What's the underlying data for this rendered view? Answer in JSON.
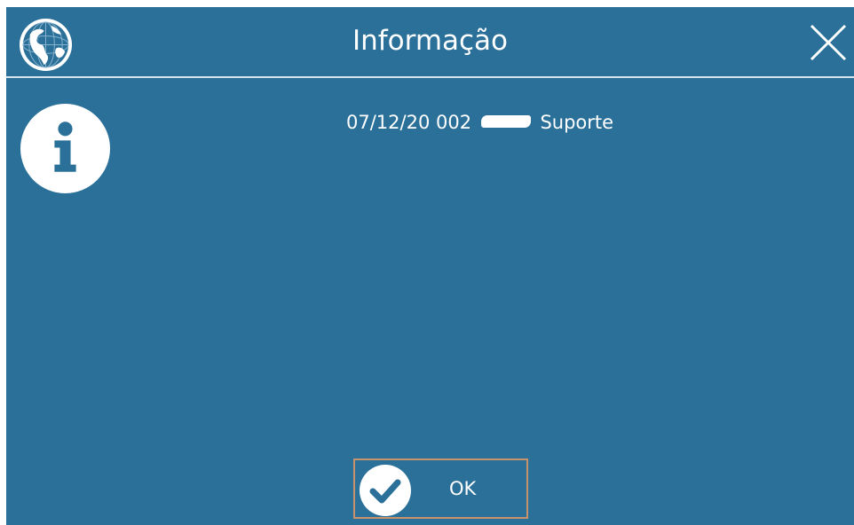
{
  "dialog": {
    "title": "Informação",
    "message_prefix": "07/12/20 002",
    "message_suffix": "Suporte",
    "ok_label": "OK"
  },
  "icons": {
    "app": "globe-icon",
    "close": "close-icon",
    "message_type": "info-icon",
    "confirm": "check-icon"
  },
  "colors": {
    "background": "#2a7099",
    "text": "#ffffff",
    "button_border": "#c9926a"
  }
}
